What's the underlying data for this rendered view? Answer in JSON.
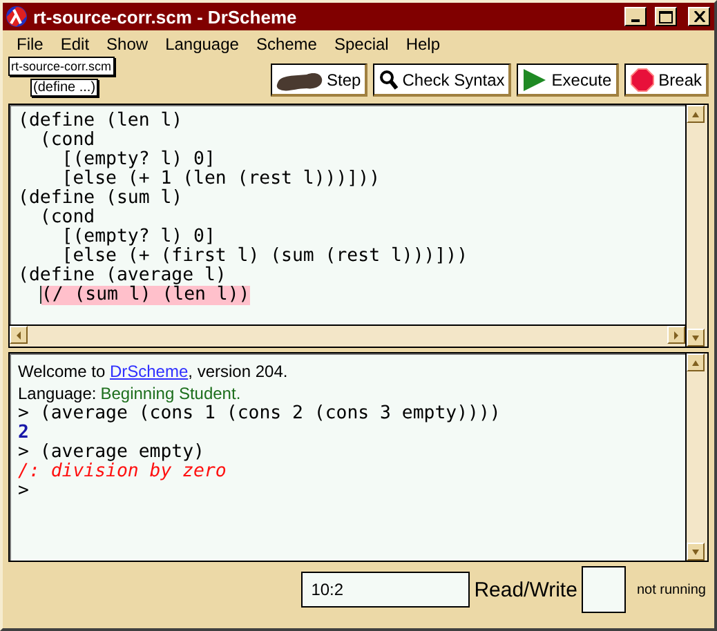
{
  "window": {
    "title": "rt-source-corr.scm - DrScheme"
  },
  "menu": [
    "File",
    "Edit",
    "Show",
    "Language",
    "Scheme",
    "Special",
    "Help"
  ],
  "file_label": "rt-source-corr.scm",
  "definition_menu": "(define ...)",
  "toolbar": [
    {
      "kind": "step",
      "label": "Step"
    },
    {
      "kind": "check",
      "label": "Check Syntax"
    },
    {
      "kind": "execute",
      "label": "Execute"
    },
    {
      "kind": "break",
      "label": "Break"
    }
  ],
  "definitions": [
    {
      "text": "(define (len l)",
      "highlighted": false
    },
    {
      "text": "  (cond",
      "highlighted": false
    },
    {
      "text": "    [(empty? l) 0]",
      "highlighted": false
    },
    {
      "text": "    [else (+ 1 (len (rest l)))]))",
      "highlighted": false
    },
    {
      "text": "(define (sum l)",
      "highlighted": false
    },
    {
      "text": "  (cond",
      "highlighted": false
    },
    {
      "text": "    [(empty? l) 0]",
      "highlighted": false
    },
    {
      "text": "    [else (+ (first l) (sum (rest l)))]))",
      "highlighted": false
    },
    {
      "text": "(define (average l)",
      "highlighted": false
    },
    {
      "text": "  (/ (sum l) (len l))",
      "highlighted": true
    }
  ],
  "interactions": [
    {
      "kind": "welcome",
      "before": "Welcome to ",
      "link": "DrScheme",
      "after": ", version 204."
    },
    {
      "kind": "language",
      "label": "Language: ",
      "value": "Beginning Student."
    },
    {
      "kind": "input",
      "prompt": ">",
      "text": "(average (cons 1 (cons 2 (cons 3 empty))))"
    },
    {
      "kind": "value",
      "text": "2"
    },
    {
      "kind": "input",
      "prompt": ">",
      "text": "(average empty)"
    },
    {
      "kind": "error",
      "text": "/: division by zero"
    },
    {
      "kind": "prompt",
      "prompt": ">"
    }
  ],
  "status_bar": {
    "position": "10:2",
    "mode": "Read/Write",
    "state": "not running"
  }
}
